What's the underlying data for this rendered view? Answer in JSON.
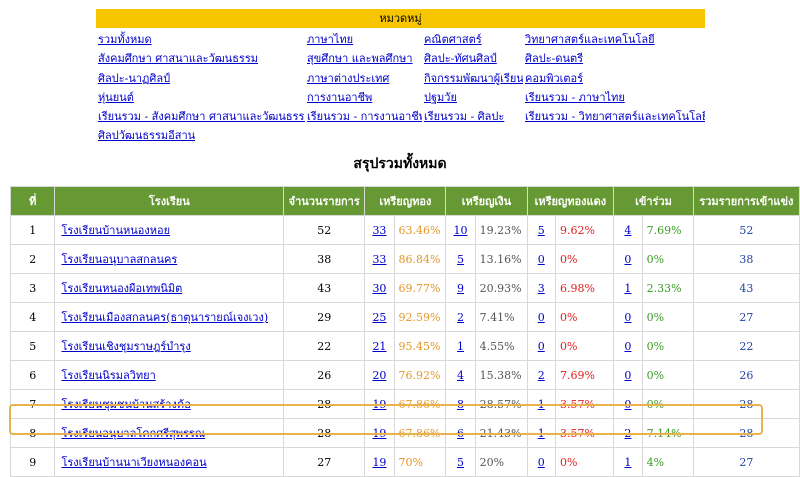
{
  "categories": {
    "header": "หมวดหมู่",
    "columns": [
      [
        "รวมทั้งหมด",
        "สังคมศึกษา ศาสนาและวัฒนธรรม",
        "ศิลปะ-นาฏศิลป์",
        "หุ่นยนต์",
        "เรียนรวม - สังคมศึกษา ศาสนาและวัฒนธรรม",
        "ศิลปวัฒนธรรมอีสาน"
      ],
      [
        "ภาษาไทย",
        "สุขศึกษา และพลศึกษา",
        "ภาษาต่างประเทศ",
        "การงานอาชีพ",
        "เรียนรวม - การงานอาชีพ"
      ],
      [
        "คณิตศาสตร์",
        "ศิลปะ-ทัศนศิลป์",
        "กิจกรรมพัฒนาผู้เรียน",
        "ปฐมวัย",
        "เรียนรวม - ศิลปะ"
      ],
      [
        "วิทยาศาสตร์และเทคโนโลยี",
        "ศิลปะ-ดนตรี",
        "คอมพิวเตอร์",
        "เรียนรวม - ภาษาไทย",
        "เรียนรวม - วิทยาศาสตร์และเทคโนโลยี"
      ]
    ]
  },
  "summary": {
    "title": "สรุปรวมทั้งหมด",
    "headers": {
      "no": "ที่",
      "school": "โรงเรียน",
      "items": "จำนวนรายการ",
      "gold": "เหรียญทอง",
      "silver": "เหรียญเงิน",
      "bronze": "เหรียญทองแดง",
      "join": "เข้าร่วม",
      "total": "รวมรายการเข้าแข่ง"
    },
    "rows": [
      {
        "no": "1",
        "school": "โรงเรียนบ้านหนองหอย",
        "items": "52",
        "gold": "33",
        "gold_pct": "63.46%",
        "silver": "10",
        "silver_pct": "19.23%",
        "bronze": "5",
        "bronze_pct": "9.62%",
        "join": "4",
        "join_pct": "7.69%",
        "total": "52"
      },
      {
        "no": "2",
        "school": "โรงเรียนอนุบาลสกลนคร",
        "items": "38",
        "gold": "33",
        "gold_pct": "86.84%",
        "silver": "5",
        "silver_pct": "13.16%",
        "bronze": "0",
        "bronze_pct": "0%",
        "join": "0",
        "join_pct": "0%",
        "total": "38"
      },
      {
        "no": "3",
        "school": "โรงเรียนหนองผือเทพนิมิต",
        "items": "43",
        "gold": "30",
        "gold_pct": "69.77%",
        "silver": "9",
        "silver_pct": "20.93%",
        "bronze": "3",
        "bronze_pct": "6.98%",
        "join": "1",
        "join_pct": "2.33%",
        "total": "43"
      },
      {
        "no": "4",
        "school": "โรงเรียนเมืองสกลนคร(ธาตุนารายณ์เจงเวง)",
        "items": "29",
        "gold": "25",
        "gold_pct": "92.59%",
        "silver": "2",
        "silver_pct": "7.41%",
        "bronze": "0",
        "bronze_pct": "0%",
        "join": "0",
        "join_pct": "0%",
        "total": "27"
      },
      {
        "no": "5",
        "school": "โรงเรียนเชิงชุมราษฎร์บำรุง",
        "items": "22",
        "gold": "21",
        "gold_pct": "95.45%",
        "silver": "1",
        "silver_pct": "4.55%",
        "bronze": "0",
        "bronze_pct": "0%",
        "join": "0",
        "join_pct": "0%",
        "total": "22"
      },
      {
        "no": "6",
        "school": "โรงเรียนนิรมลวิทยา",
        "items": "26",
        "gold": "20",
        "gold_pct": "76.92%",
        "silver": "4",
        "silver_pct": "15.38%",
        "bronze": "2",
        "bronze_pct": "7.69%",
        "join": "0",
        "join_pct": "0%",
        "total": "26"
      },
      {
        "no": "7",
        "school": "โรงเรียนชุมชนบ้านสร้างค้อ",
        "items": "28",
        "gold": "19",
        "gold_pct": "67.86%",
        "silver": "8",
        "silver_pct": "28.57%",
        "bronze": "1",
        "bronze_pct": "3.57%",
        "join": "0",
        "join_pct": "0%",
        "total": "28"
      },
      {
        "no": "8",
        "school": "โรงเรียนอนุบาลโคกศรีสุพรรณ",
        "items": "28",
        "gold": "19",
        "gold_pct": "67.86%",
        "silver": "6",
        "silver_pct": "21.43%",
        "bronze": "1",
        "bronze_pct": "3.57%",
        "join": "2",
        "join_pct": "7.14%",
        "total": "28"
      },
      {
        "no": "9",
        "school": "โรงเรียนบ้านนาเวียงหนองคอน",
        "items": "27",
        "gold": "19",
        "gold_pct": "70%",
        "silver": "5",
        "silver_pct": "20%",
        "bronze": "0",
        "bronze_pct": "0%",
        "join": "1",
        "join_pct": "4%",
        "total": "27"
      }
    ]
  },
  "colors": {
    "header_bg": "#669933",
    "category_bar": "#f7c600",
    "gold_pct": "#e2972b",
    "bronze_pct": "#e0201d",
    "join_pct": "#3a9b25",
    "highlight": "#e8b24c"
  }
}
